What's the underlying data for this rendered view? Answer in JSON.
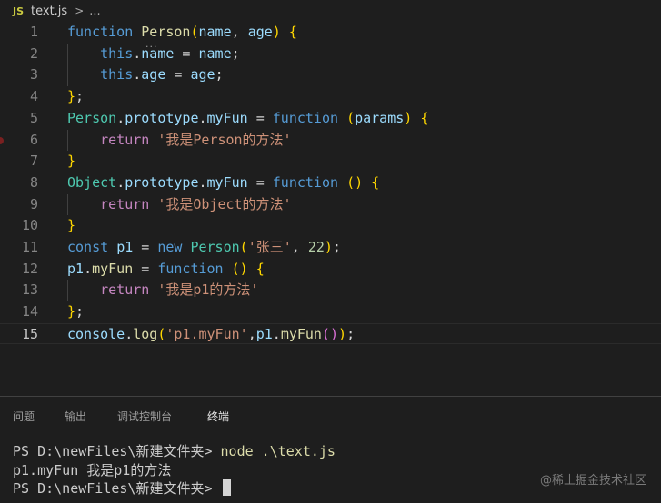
{
  "breadcrumb": {
    "badge": "JS",
    "file": "text.js",
    "chevron": ">",
    "more": "..."
  },
  "editor": {
    "hover_dots": "...",
    "line_numbers": [
      "1",
      "2",
      "3",
      "4",
      "5",
      "6",
      "7",
      "8",
      "9",
      "10",
      "11",
      "12",
      "13",
      "14",
      "15"
    ],
    "lines": [
      [
        [
          "kw",
          "function"
        ],
        [
          "plain",
          " "
        ],
        [
          "fn",
          "Person"
        ],
        [
          "p1",
          "("
        ],
        [
          "var",
          "name"
        ],
        [
          "plain",
          ", "
        ],
        [
          "var",
          "age"
        ],
        [
          "p1",
          ")"
        ],
        [
          "plain",
          " "
        ],
        [
          "p1",
          "{"
        ]
      ],
      [
        [
          "plain",
          "    "
        ],
        [
          "kw",
          "this"
        ],
        [
          "plain",
          "."
        ],
        [
          "var",
          "name"
        ],
        [
          "plain",
          " = "
        ],
        [
          "var",
          "name"
        ],
        [
          "plain",
          ";"
        ]
      ],
      [
        [
          "plain",
          "    "
        ],
        [
          "kw",
          "this"
        ],
        [
          "plain",
          "."
        ],
        [
          "var",
          "age"
        ],
        [
          "plain",
          " = "
        ],
        [
          "var",
          "age"
        ],
        [
          "plain",
          ";"
        ]
      ],
      [
        [
          "p1",
          "}"
        ],
        [
          "plain",
          ";"
        ]
      ],
      [
        [
          "cls",
          "Person"
        ],
        [
          "plain",
          "."
        ],
        [
          "var",
          "prototype"
        ],
        [
          "plain",
          "."
        ],
        [
          "var",
          "myFun"
        ],
        [
          "plain",
          " = "
        ],
        [
          "kw",
          "function"
        ],
        [
          "plain",
          " "
        ],
        [
          "p1",
          "("
        ],
        [
          "var",
          "params"
        ],
        [
          "p1",
          ")"
        ],
        [
          "plain",
          " "
        ],
        [
          "p1",
          "{"
        ]
      ],
      [
        [
          "plain",
          "    "
        ],
        [
          "ctl",
          "return"
        ],
        [
          "plain",
          " "
        ],
        [
          "str",
          "'我是Person的方法'"
        ]
      ],
      [
        [
          "p1",
          "}"
        ]
      ],
      [
        [
          "cls",
          "Object"
        ],
        [
          "plain",
          "."
        ],
        [
          "var",
          "prototype"
        ],
        [
          "plain",
          "."
        ],
        [
          "var",
          "myFun"
        ],
        [
          "plain",
          " = "
        ],
        [
          "kw",
          "function"
        ],
        [
          "plain",
          " "
        ],
        [
          "p1",
          "()"
        ],
        [
          "plain",
          " "
        ],
        [
          "p1",
          "{"
        ]
      ],
      [
        [
          "plain",
          "    "
        ],
        [
          "ctl",
          "return"
        ],
        [
          "plain",
          " "
        ],
        [
          "str",
          "'我是Object的方法'"
        ]
      ],
      [
        [
          "p1",
          "}"
        ]
      ],
      [
        [
          "kw",
          "const"
        ],
        [
          "plain",
          " "
        ],
        [
          "var",
          "p1"
        ],
        [
          "plain",
          " = "
        ],
        [
          "kw",
          "new"
        ],
        [
          "plain",
          " "
        ],
        [
          "cls",
          "Person"
        ],
        [
          "p1",
          "("
        ],
        [
          "str",
          "'张三'"
        ],
        [
          "plain",
          ", "
        ],
        [
          "num",
          "22"
        ],
        [
          "p1",
          ")"
        ],
        [
          "plain",
          ";"
        ]
      ],
      [
        [
          "var",
          "p1"
        ],
        [
          "plain",
          "."
        ],
        [
          "fn",
          "myFun"
        ],
        [
          "plain",
          " = "
        ],
        [
          "kw",
          "function"
        ],
        [
          "plain",
          " "
        ],
        [
          "p1",
          "()"
        ],
        [
          "plain",
          " "
        ],
        [
          "p1",
          "{"
        ]
      ],
      [
        [
          "plain",
          "    "
        ],
        [
          "ctl",
          "return"
        ],
        [
          "plain",
          " "
        ],
        [
          "str",
          "'我是p1的方法'"
        ]
      ],
      [
        [
          "p1",
          "}"
        ],
        [
          "plain",
          ";"
        ]
      ],
      [
        [
          "var",
          "console"
        ],
        [
          "plain",
          "."
        ],
        [
          "fn",
          "log"
        ],
        [
          "p1",
          "("
        ],
        [
          "str",
          "'p1.myFun'"
        ],
        [
          "plain",
          ","
        ],
        [
          "var",
          "p1"
        ],
        [
          "plain",
          "."
        ],
        [
          "fn",
          "myFun"
        ],
        [
          "p2",
          "()"
        ],
        [
          "p1",
          ")"
        ],
        [
          "plain",
          ";"
        ]
      ]
    ]
  },
  "panel": {
    "tabs": [
      {
        "label": "问题",
        "active": false
      },
      {
        "label": "输出",
        "active": false
      },
      {
        "label": "调试控制台",
        "active": false
      },
      {
        "label": "终端",
        "active": true
      }
    ]
  },
  "terminal": {
    "prompt1": "PS D:\\newFiles\\新建文件夹> ",
    "command": "node .\\text.js",
    "output": "p1.myFun 我是p1的方法",
    "prompt2": "PS D:\\newFiles\\新建文件夹> "
  },
  "watermark": "@稀土掘金技术社区"
}
